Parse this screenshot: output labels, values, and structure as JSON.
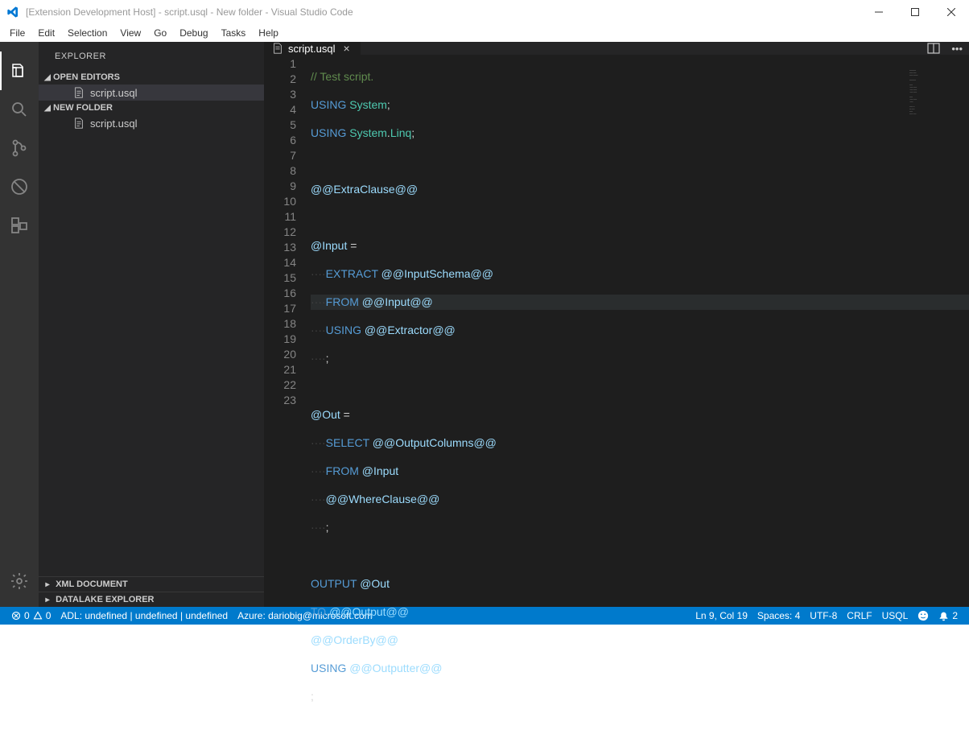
{
  "title": "[Extension Development Host] - script.usql - New folder - Visual Studio Code",
  "menu": [
    "File",
    "Edit",
    "Selection",
    "View",
    "Go",
    "Debug",
    "Tasks",
    "Help"
  ],
  "sidebar": {
    "title": "EXPLORER",
    "sections": {
      "openEditors": {
        "label": "OPEN EDITORS",
        "item": "script.usql"
      },
      "folder": {
        "label": "NEW FOLDER",
        "item": "script.usql"
      },
      "xml": {
        "label": "XML DOCUMENT"
      },
      "datalake": {
        "label": "DATALAKE EXPLORER"
      }
    }
  },
  "tab": {
    "name": "script.usql"
  },
  "code": {
    "lines": 23,
    "highlight": 9,
    "l1": "// Test script.",
    "l2a": "USING",
    "l2b": "System",
    "l2c": ";",
    "l3a": "USING",
    "l3b": "System",
    "l3c": ".",
    "l3d": "Linq",
    "l3e": ";",
    "l5": "@@ExtraClause@@",
    "l7a": "@Input",
    "l7b": " = ",
    "l8a": "····",
    "l8b": "EXTRACT",
    "l8c": "@@InputSchema@@",
    "l9a": "····",
    "l9b": "FROM",
    "l9c": "@@Input@@",
    "l10a": "····",
    "l10b": "USING",
    "l10c": "@@Extractor@@",
    "l11a": "····",
    "l11b": ";",
    "l13a": "@Out",
    "l13b": " = ",
    "l14a": "····",
    "l14b": "SELECT",
    "l14c": "@@OutputColumns@@",
    "l15a": "····",
    "l15b": "FROM",
    "l15c": "@Input",
    "l16a": "····",
    "l16b": "@@WhereClause@@",
    "l17a": "····",
    "l17b": ";",
    "l19a": "OUTPUT",
    "l19b": "@Out",
    "l20a": "TO",
    "l20b": "@@Output@@",
    "l21": "@@OrderBy@@",
    "l22a": "USING",
    "l22b": "@@Outputter@@",
    "l23": ";"
  },
  "status": {
    "errors": "0",
    "warnings": "0",
    "adl": "ADL: undefined | undefined | undefined",
    "azure": "Azure: dariobig@microsoft.com",
    "lncol": "Ln 9, Col 19",
    "spaces": "Spaces: 4",
    "encoding": "UTF-8",
    "eol": "CRLF",
    "lang": "USQL",
    "bell": "2"
  }
}
